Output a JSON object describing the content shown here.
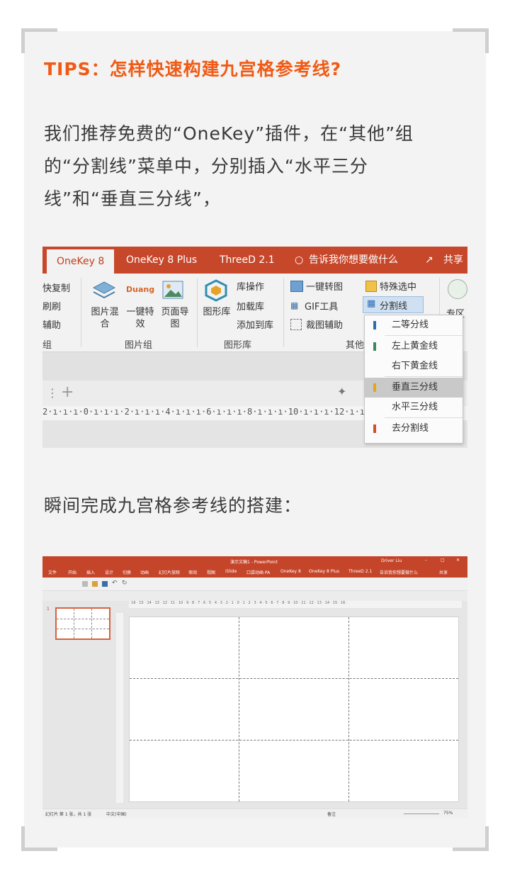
{
  "article": {
    "title": "TIPS：怎样快速构建九宫格参考线?",
    "para1_line1": "我们推荐免费的“OneKey”插件，在“其他”组",
    "para1_line2": "的“分割线”菜单中，分别插入“水平三分",
    "para1_line3": "线”和“垂直三分线”，",
    "para2": "瞬间完成九宫格参考线的搭建："
  },
  "ribbon_shot": {
    "tabs": [
      "OneKey 8",
      "OneKey 8 Plus",
      "ThreeD 2.1"
    ],
    "tell_me": "告诉我你想要做什么",
    "share": "共享",
    "left_items": [
      "快复制",
      "刷刷",
      "辅助",
      "组"
    ],
    "picture_group": {
      "buttons": [
        "图片混合",
        "一键特效",
        "页面导图"
      ],
      "label": "图片组",
      "duang": "Duang"
    },
    "graphics_group": {
      "big_button": "图形库",
      "items": [
        "库操作",
        "加载库",
        "添加到库"
      ],
      "label": "图形库"
    },
    "other_group": {
      "items": [
        "一键转图",
        "GIF工具",
        "裁图辅助",
        "特殊选中",
        "分割线"
      ],
      "label": "其他",
      "right_partial": "专区"
    },
    "menu": [
      {
        "label": "二等分线",
        "color": "#2e6db4"
      },
      {
        "label": "左上黄金线",
        "color": "#3d8a5a"
      },
      {
        "label": "右下黄金线",
        "color": ""
      },
      {
        "label": "垂直三分线",
        "color": "#e8a319"
      },
      {
        "label": "水平三分线",
        "color": ""
      },
      {
        "label": "去分割线",
        "color": "#d2502a"
      }
    ],
    "ruler": "2·ı·ı·ı·0·ı·ı·ı·2·ı·ı·ı·4·ı·ı·ı·6·ı·ı·ı·8·ı·ı·ı·10·ı·ı·ı·12·ı·ı·ı"
  },
  "ppt_shot": {
    "window_title": "演示文稿1 - PowerPoint",
    "user": "Driver Liu",
    "tabs": [
      "文件",
      "开始",
      "插入",
      "设计",
      "切换",
      "动画",
      "幻灯片放映",
      "审阅",
      "视图",
      "iSlide",
      "口袋动画 PA",
      "OneKey 8",
      "OneKey 8 Plus",
      "ThreeD 2.1"
    ],
    "tell_me": "告诉我你想要做什么",
    "share": "共享",
    "slide_number": "1",
    "ruler_text": "· 16 · 15 · 14 · 13 · 12 · 11 · 10 · 9 · 8 · 7 · 6 · 5 · 4 · 3 · 2 · 1 · 0 · 1 · 2 · 3 · 4 · 5 · 6 · 7 · 8 · 9 · 10 · 11 · 12 · 13 · 14 · 15 · 16 ·",
    "status_left": "幻灯片 第 1 张，共 1 张",
    "status_lang": "中文(中国)",
    "status_notes": "备注",
    "zoom": "75%",
    "grid": {
      "columns": 3,
      "rows": 3
    }
  }
}
